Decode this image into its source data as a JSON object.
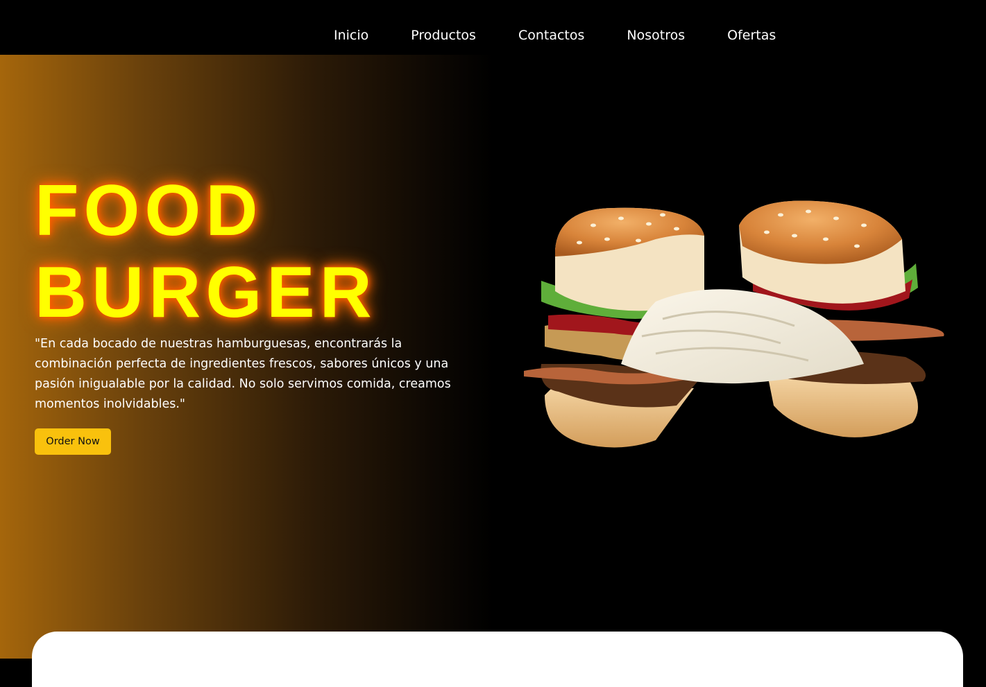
{
  "nav": {
    "items": [
      {
        "label": "Inicio"
      },
      {
        "label": "Productos"
      },
      {
        "label": "Contactos"
      },
      {
        "label": "Nosotros"
      },
      {
        "label": "Ofertas"
      }
    ]
  },
  "hero": {
    "title_line1": "FOOD",
    "title_line2": "BURGER",
    "description": "\"En cada bocado de nuestras hamburguesas, encontrarás la combinación perfecta de ingredientes frescos, sabores únicos y una pasión inigualable por la calidad. No solo servimos comida, creamos momentos inolvidables.\"",
    "cta_label": "Order Now",
    "image_icon": "burger-image"
  },
  "colors": {
    "title": "#ffff00",
    "title_glow": "#ff5a00",
    "cta_bg": "#f9c10d",
    "gradient_start": "#a5660c",
    "background": "#000000"
  }
}
